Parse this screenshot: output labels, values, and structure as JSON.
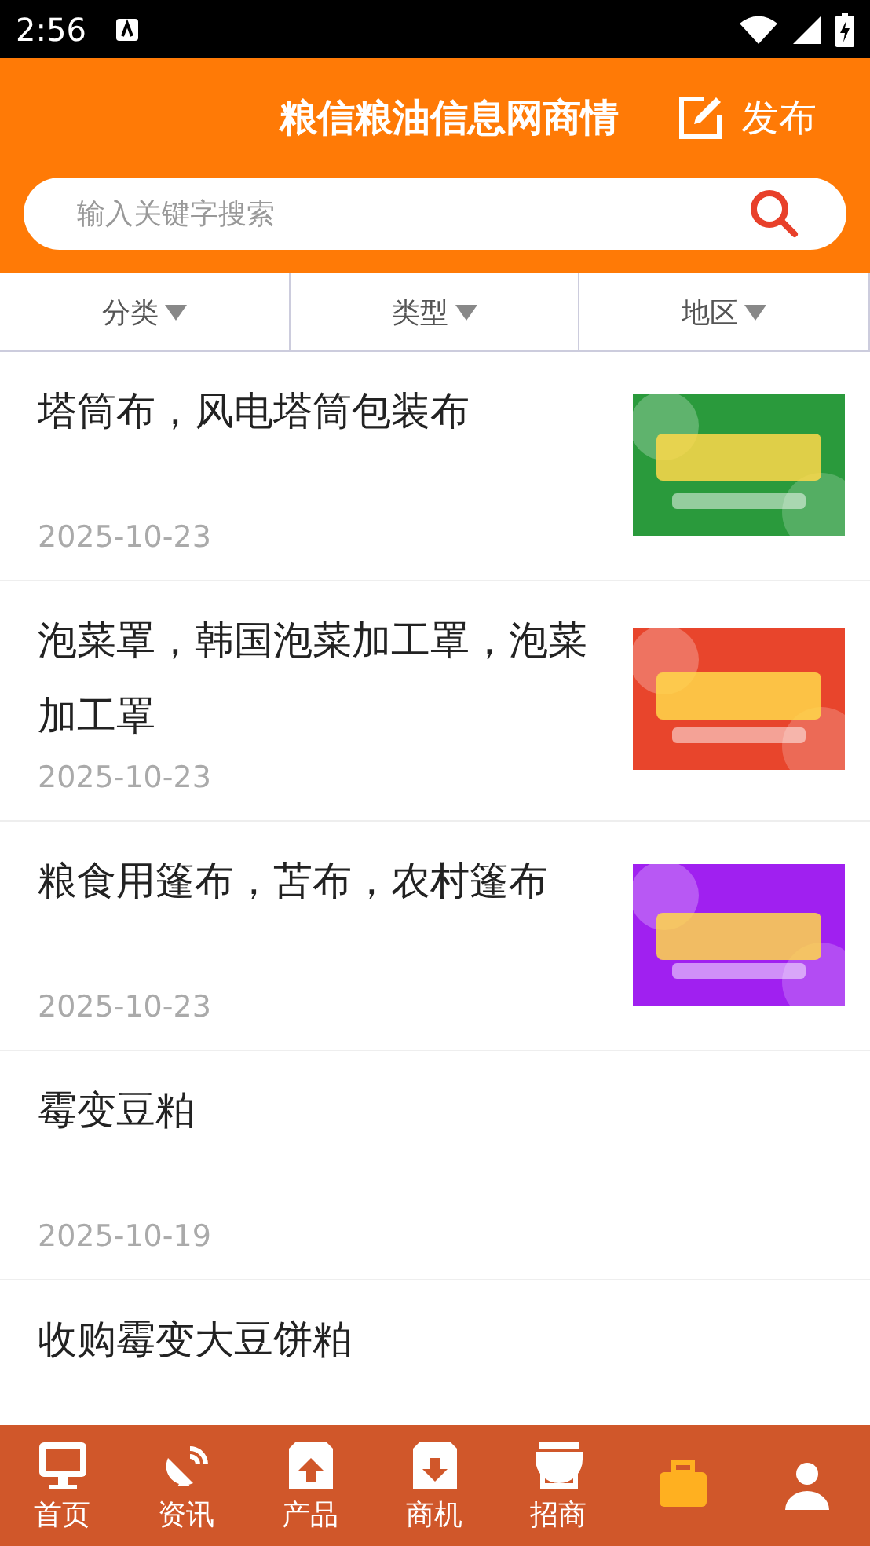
{
  "status_bar": {
    "time": "2:56"
  },
  "header": {
    "title": "粮信粮油信息网商情",
    "publish": "发布"
  },
  "search": {
    "placeholder": "输入关键字搜索"
  },
  "filters": [
    {
      "label": "分类"
    },
    {
      "label": "类型"
    },
    {
      "label": "地区"
    }
  ],
  "items": [
    {
      "title": "塔筒布，风电塔筒包装布",
      "date": "2025-10-23"
    },
    {
      "title": "泡菜罩，韩国泡菜加工罩，泡菜加工罩",
      "date": "2025-10-23"
    },
    {
      "title": "粮食用篷布，苫布，农村篷布",
      "date": "2025-10-23"
    },
    {
      "title": "霉变豆粕",
      "date": "2025-10-19"
    },
    {
      "title": "收购霉变大豆饼粕"
    }
  ],
  "nav": [
    {
      "label": "首页",
      "selected": false
    },
    {
      "label": "资讯",
      "selected": false
    },
    {
      "label": "产品",
      "selected": false
    },
    {
      "label": "商机",
      "selected": false
    },
    {
      "label": "招商",
      "selected": false
    },
    {
      "selected": true
    },
    {
      "selected": false
    }
  ]
}
